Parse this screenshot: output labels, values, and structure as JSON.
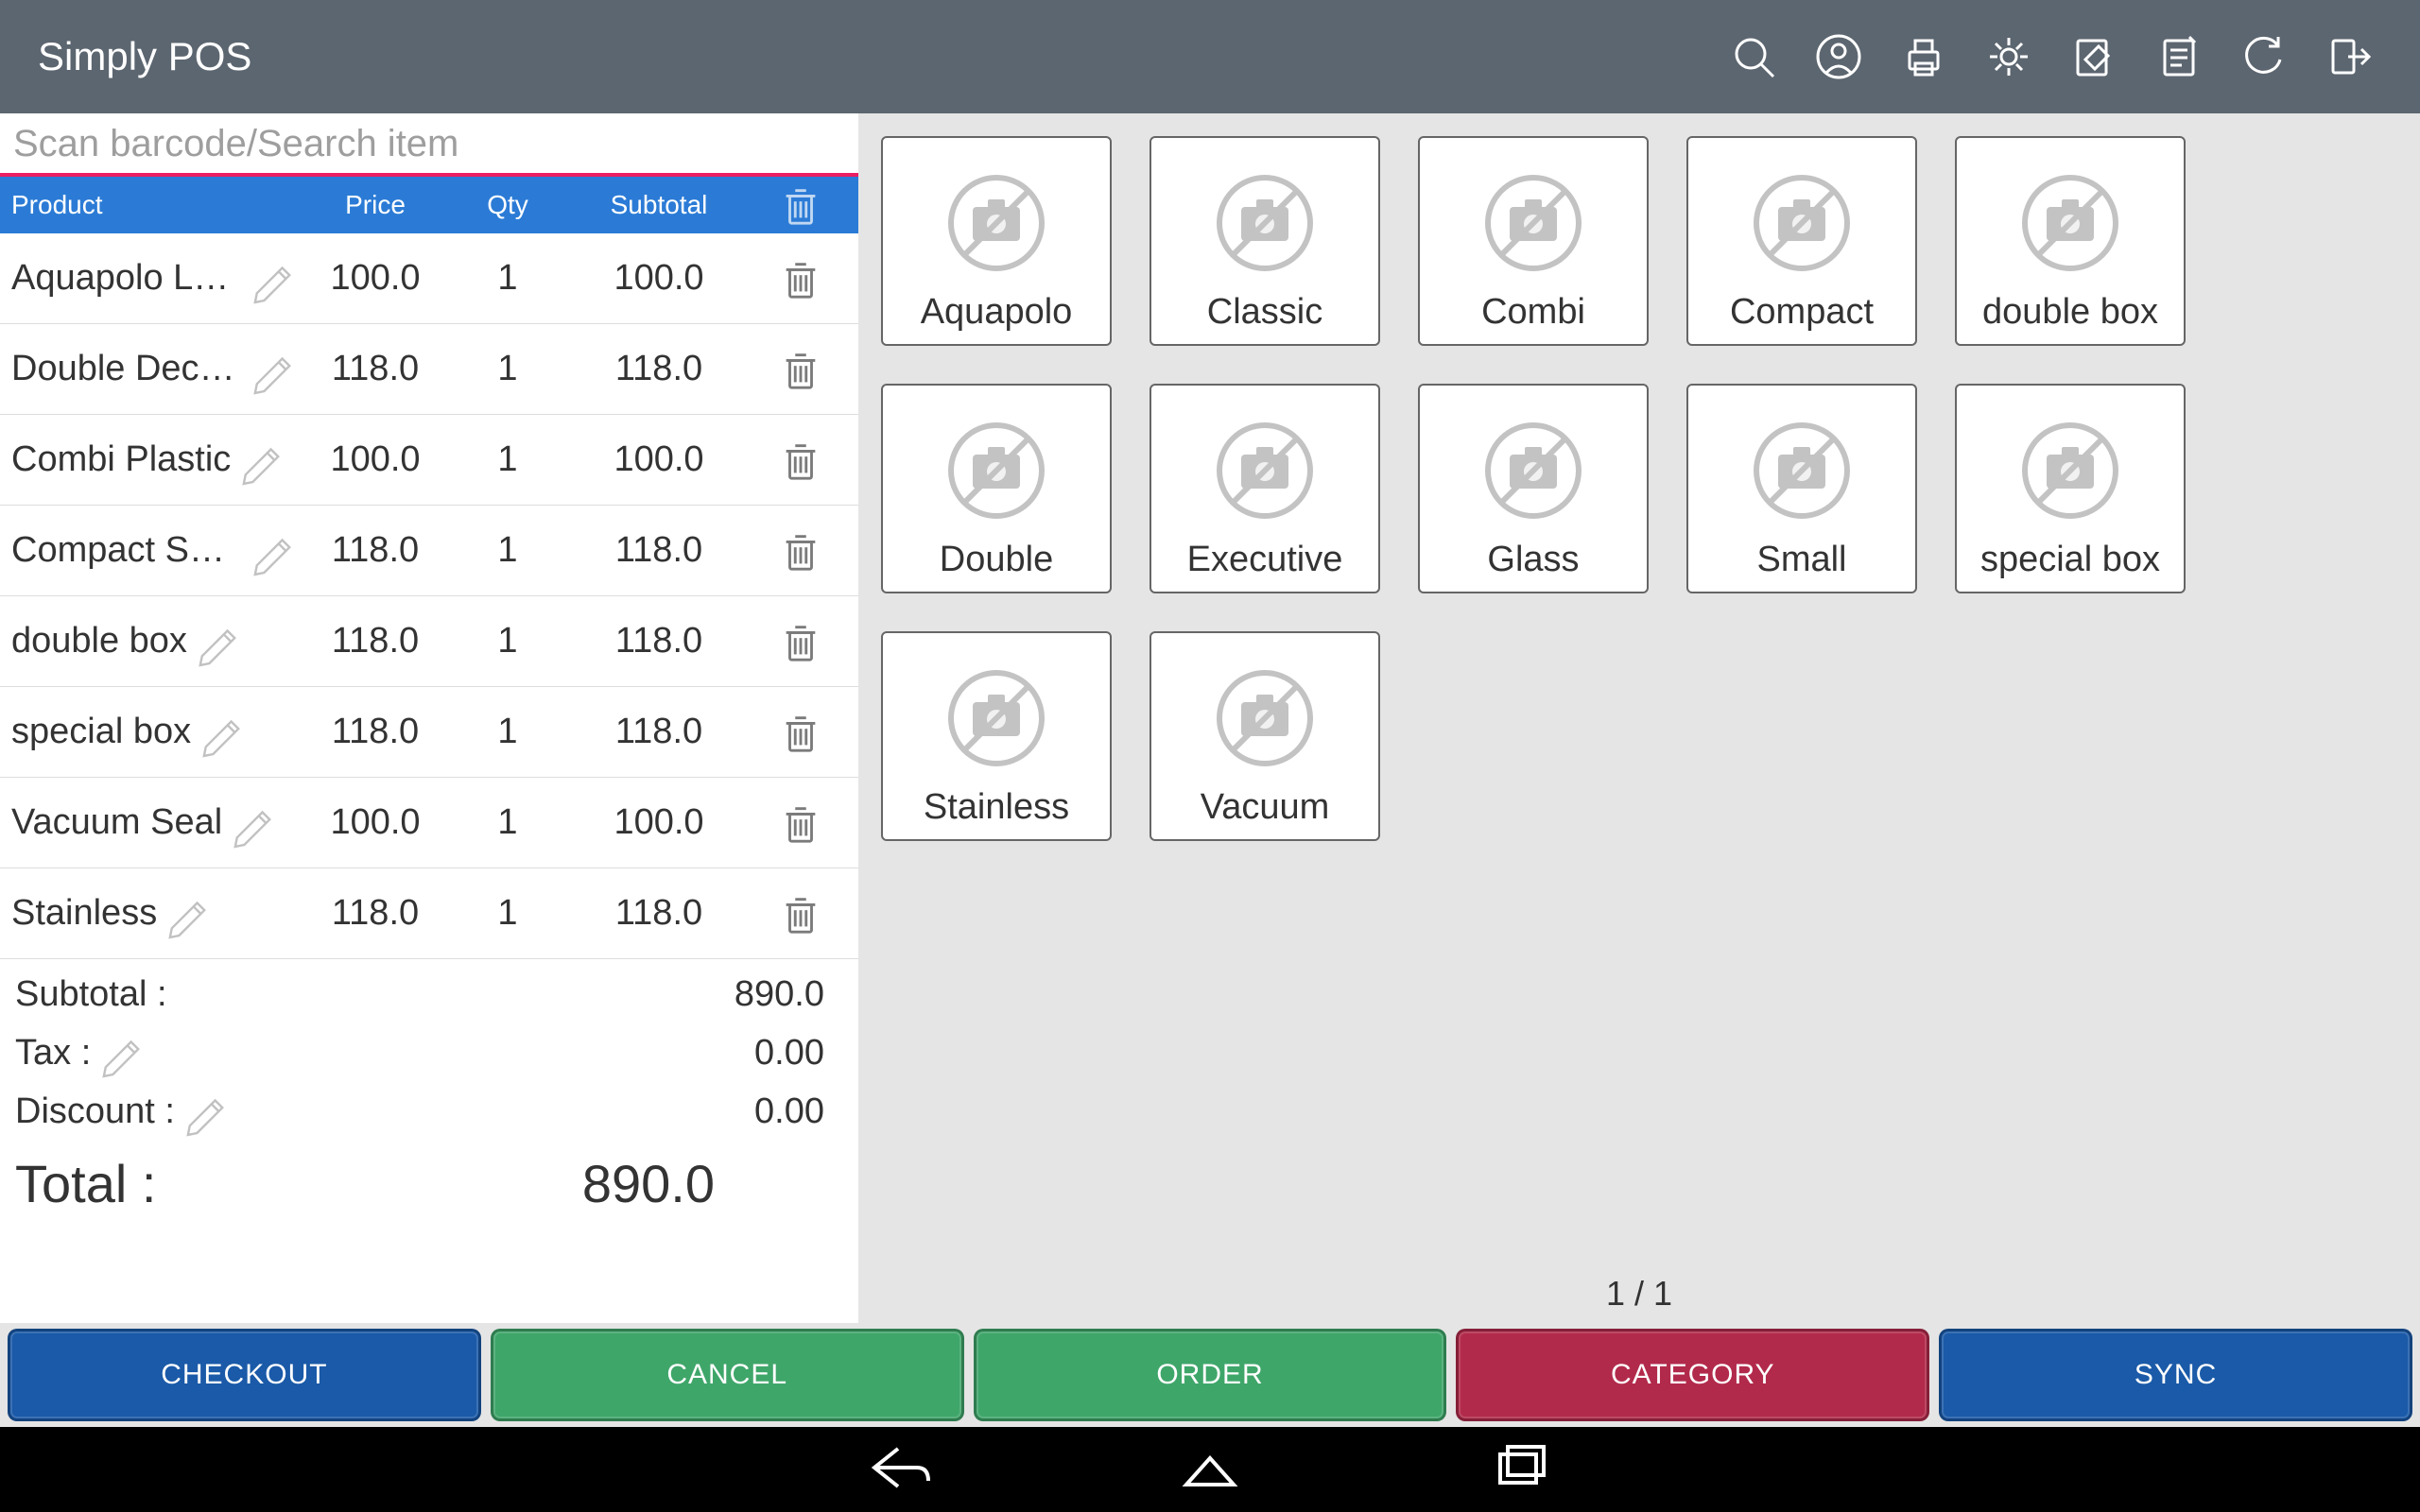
{
  "app_title": "Simply POS",
  "search": {
    "placeholder": "Scan barcode/Search item",
    "value": ""
  },
  "table_headers": {
    "product": "Product",
    "price": "Price",
    "qty": "Qty",
    "subtotal": "Subtotal"
  },
  "cart": [
    {
      "name": "Aquapolo Lunch",
      "price": "100.0",
      "qty": "1",
      "subtotal": "100.0"
    },
    {
      "name": "Double Decker",
      "price": "118.0",
      "qty": "1",
      "subtotal": "118.0"
    },
    {
      "name": "Combi Plastic",
      "price": "100.0",
      "qty": "1",
      "subtotal": "100.0"
    },
    {
      "name": "Compact Small",
      "price": "118.0",
      "qty": "1",
      "subtotal": "118.0"
    },
    {
      "name": "double box",
      "price": "118.0",
      "qty": "1",
      "subtotal": "118.0"
    },
    {
      "name": "special box",
      "price": "118.0",
      "qty": "1",
      "subtotal": "118.0"
    },
    {
      "name": "Vacuum Seal",
      "price": "100.0",
      "qty": "1",
      "subtotal": "100.0"
    },
    {
      "name": "Stainless",
      "price": "118.0",
      "qty": "1",
      "subtotal": "118.0"
    }
  ],
  "totals": {
    "subtotal_label": "Subtotal :",
    "subtotal": "890.0",
    "tax_label": "Tax :",
    "tax": "0.00",
    "discount_label": "Discount :",
    "discount": "0.00",
    "total_label": "Total :",
    "total": "890.0"
  },
  "products": [
    {
      "label": "Aquapolo"
    },
    {
      "label": "Classic"
    },
    {
      "label": "Combi"
    },
    {
      "label": "Compact"
    },
    {
      "label": "double box"
    },
    {
      "label": "Double"
    },
    {
      "label": "Executive"
    },
    {
      "label": "Glass"
    },
    {
      "label": "Small"
    },
    {
      "label": "special box"
    },
    {
      "label": "Stainless"
    },
    {
      "label": "Vacuum"
    }
  ],
  "pager": "1 / 1",
  "actions": {
    "checkout": "CHECKOUT",
    "cancel": "CANCEL",
    "order": "ORDER",
    "category": "CATEGORY",
    "sync": "SYNC"
  },
  "colors": {
    "header": "#5c6670",
    "accent_blue": "#2b7bd6",
    "pink_underline": "#e91e63"
  }
}
